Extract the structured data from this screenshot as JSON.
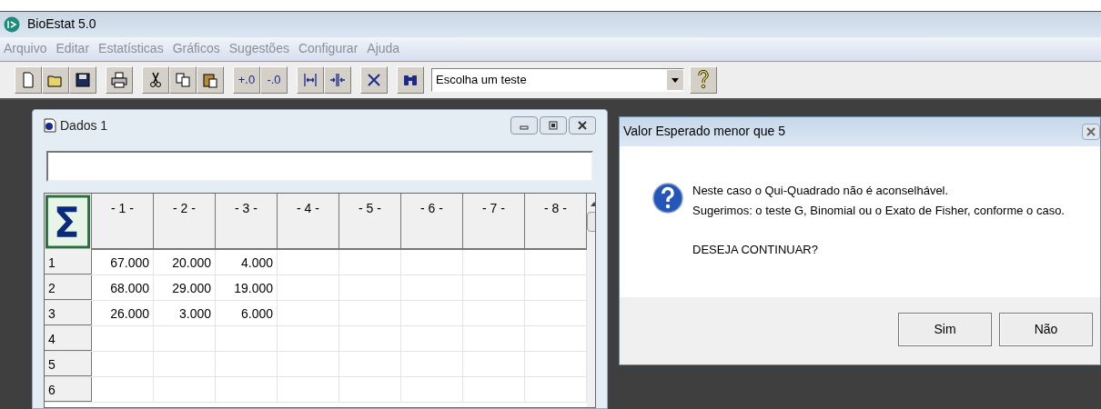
{
  "app": {
    "title": "BioEstat 5.0"
  },
  "menu": [
    {
      "label": "Arquivo",
      "disabled": true
    },
    {
      "label": "Editar",
      "disabled": true
    },
    {
      "label": "Estatísticas",
      "disabled": true
    },
    {
      "label": "Gráficos",
      "disabled": true
    },
    {
      "label": "Sugestões",
      "disabled": true
    },
    {
      "label": "Configurar",
      "disabled": true
    },
    {
      "label": "Ajuda",
      "disabled": true
    }
  ],
  "toolbar": [
    {
      "kind": "new"
    },
    {
      "kind": "open"
    },
    {
      "kind": "save"
    },
    {
      "kind": "separator"
    },
    {
      "kind": "print"
    },
    {
      "kind": "separator"
    },
    {
      "kind": "cut"
    },
    {
      "kind": "copy"
    },
    {
      "kind": "paste"
    },
    {
      "kind": "separator"
    },
    {
      "kind": "text",
      "label": "+.0"
    },
    {
      "kind": "text",
      "label": "-.0"
    },
    {
      "kind": "separator"
    },
    {
      "kind": "widen"
    },
    {
      "kind": "split"
    },
    {
      "kind": "separator"
    },
    {
      "kind": "delete"
    },
    {
      "kind": "separator"
    },
    {
      "kind": "find"
    }
  ],
  "test_select": {
    "value": "Escolha um teste"
  },
  "data_window": {
    "title": "Dados 1",
    "columns": [
      "- 1 -",
      "- 2 -",
      "- 3 -",
      "- 4 -",
      "- 5 -",
      "- 6 -",
      "- 7 -",
      "- 8 -"
    ],
    "rows": [
      {
        "label": "1",
        "cells": [
          "67.000",
          "20.000",
          "4.000"
        ]
      },
      {
        "label": "2",
        "cells": [
          "68.000",
          "29.000",
          "19.000"
        ]
      },
      {
        "label": "3",
        "cells": [
          "26.000",
          "3.000",
          "6.000"
        ]
      },
      {
        "label": "4",
        "cells": []
      },
      {
        "label": "5",
        "cells": []
      },
      {
        "label": "6",
        "cells": []
      }
    ]
  },
  "dialog": {
    "title": "Valor Esperado menor que 5",
    "message_lines": [
      "Neste caso o Qui-Quadrado não é aconselhável.",
      "Sugerimos: o teste G, Binomial ou o Exato de Fisher, conforme o caso."
    ],
    "question": "DESEJA CONTINUAR?",
    "buttons": [
      {
        "label": "Sim"
      },
      {
        "label": "Não"
      }
    ]
  }
}
